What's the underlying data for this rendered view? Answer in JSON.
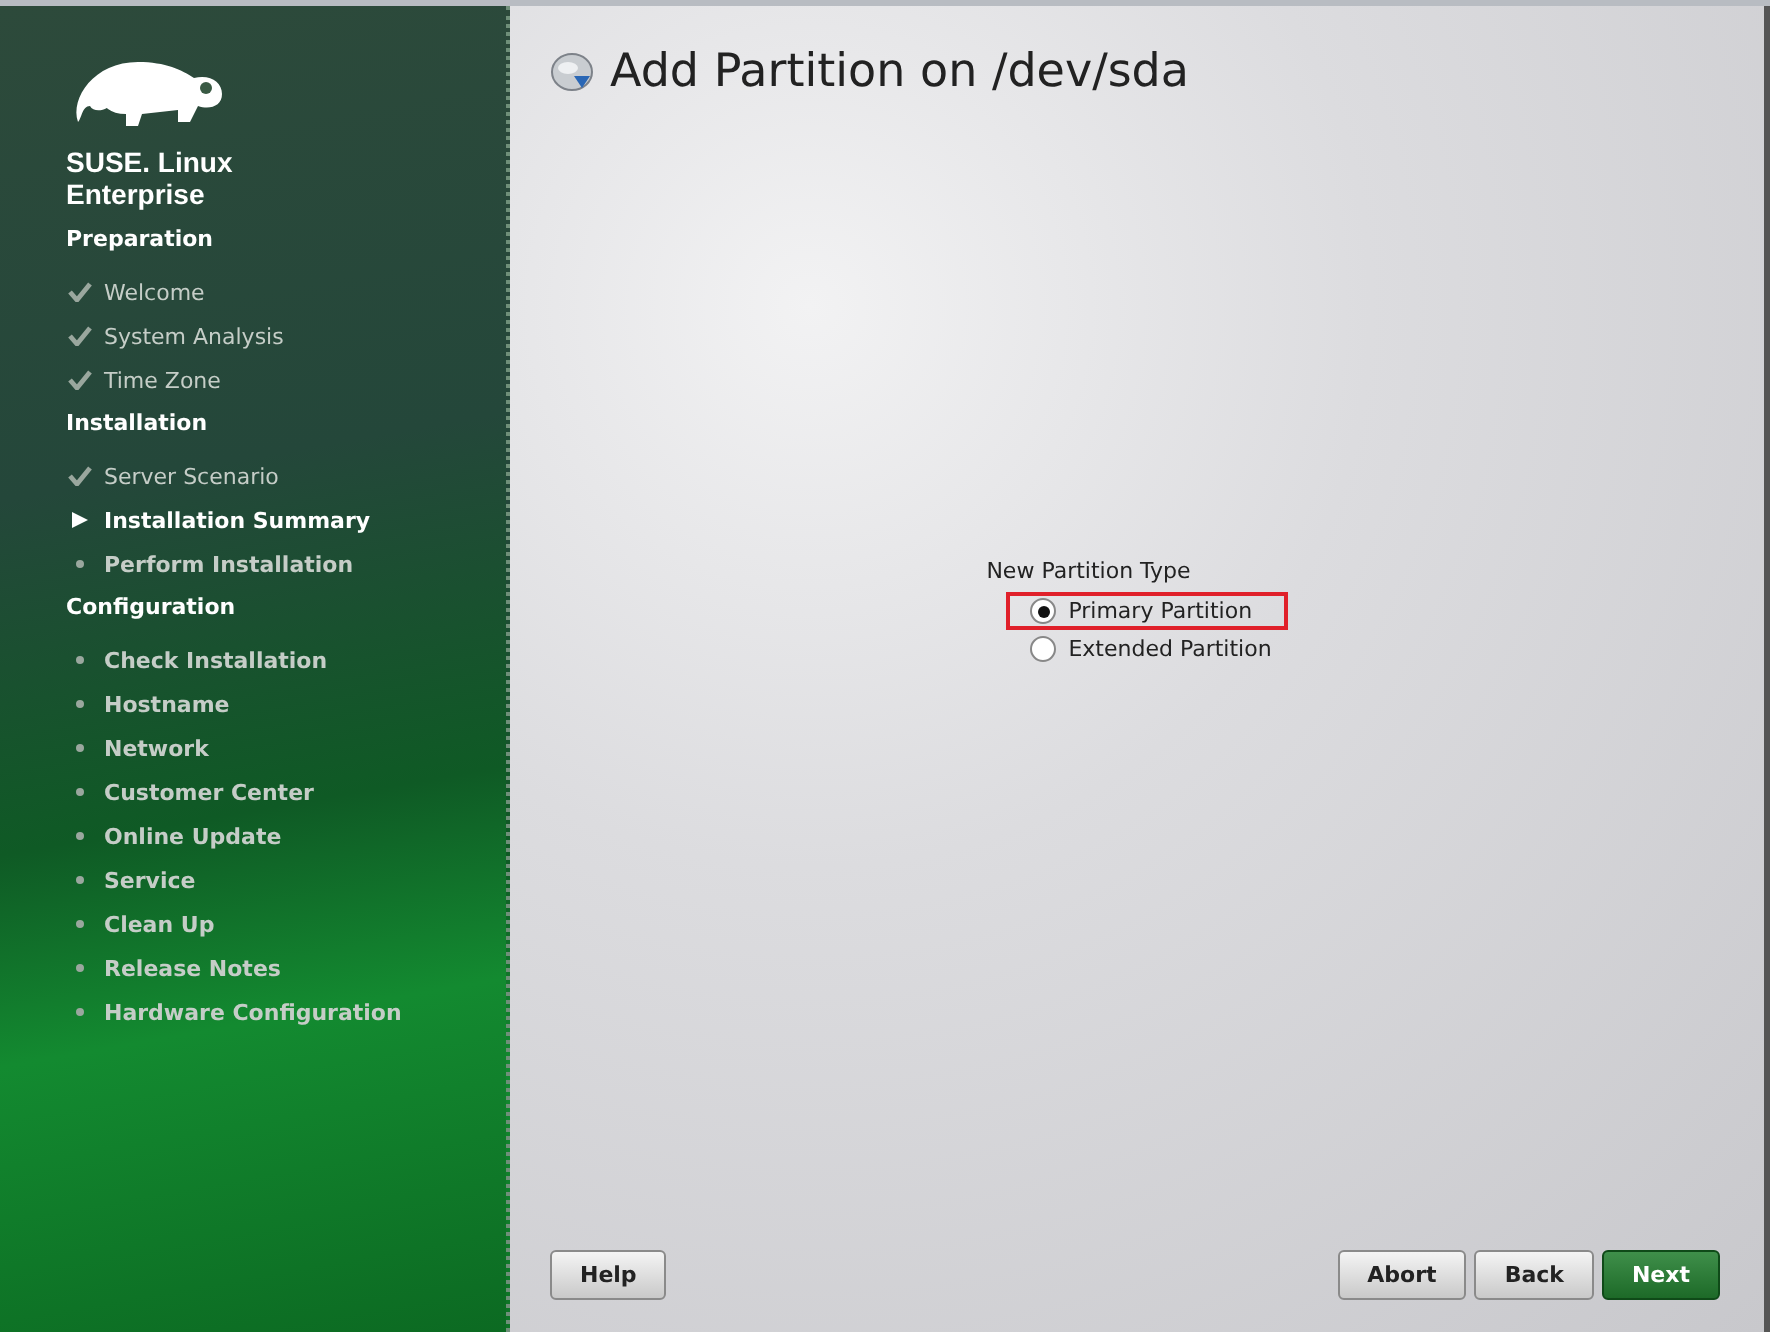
{
  "sidebar": {
    "brand": [
      "SUSE. Linux",
      "Enterprise"
    ],
    "sections": [
      {
        "title": "Preparation",
        "steps": [
          {
            "label": "Welcome",
            "kind": "done"
          },
          {
            "label": "System Analysis",
            "kind": "done"
          },
          {
            "label": "Time Zone",
            "kind": "done"
          }
        ]
      },
      {
        "title": "Installation",
        "steps": [
          {
            "label": "Server Scenario",
            "kind": "done"
          },
          {
            "label": "Installation Summary",
            "kind": "current"
          },
          {
            "label": "Perform Installation",
            "kind": "pending"
          }
        ]
      },
      {
        "title": "Configuration",
        "steps": [
          {
            "label": "Check Installation",
            "kind": "pending"
          },
          {
            "label": "Hostname",
            "kind": "pending"
          },
          {
            "label": "Network",
            "kind": "pending"
          },
          {
            "label": "Customer Center",
            "kind": "pending"
          },
          {
            "label": "Online Update",
            "kind": "pending"
          },
          {
            "label": "Service",
            "kind": "pending"
          },
          {
            "label": "Clean Up",
            "kind": "pending"
          },
          {
            "label": "Release Notes",
            "kind": "pending"
          },
          {
            "label": "Hardware Configuration",
            "kind": "pending"
          }
        ]
      }
    ]
  },
  "page_title": "Add Partition on /dev/sda",
  "partition_type": {
    "label": "New Partition Type",
    "options": [
      {
        "label": "Primary Partition",
        "selected": true,
        "highlighted": true
      },
      {
        "label": "Extended Partition",
        "selected": false,
        "highlighted": false
      }
    ]
  },
  "buttons": {
    "left": [
      {
        "label": "Help"
      }
    ],
    "right": [
      {
        "label": "Abort",
        "kind": "plain"
      },
      {
        "label": "Back",
        "kind": "plain"
      },
      {
        "label": "Next",
        "kind": "primary"
      }
    ]
  }
}
